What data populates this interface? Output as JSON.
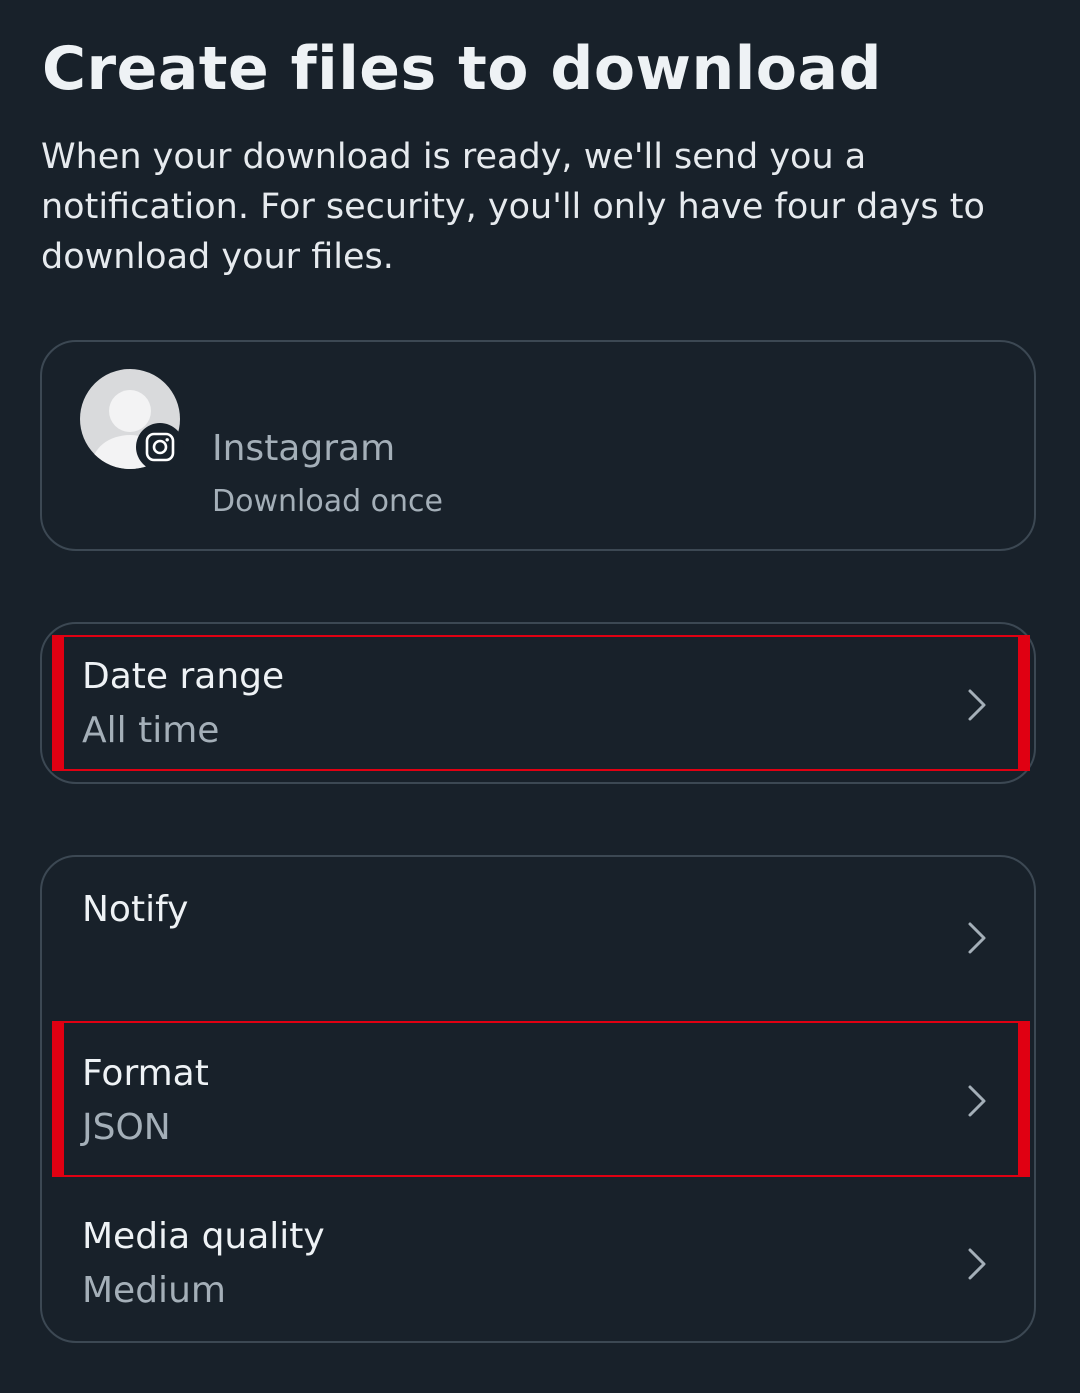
{
  "header": {
    "title": "Create files to download",
    "description": "When your download is ready, we'll send you a notification. For security, you'll only have four days to download your files."
  },
  "account": {
    "name": "Instagram",
    "download_mode": "Download once",
    "avatar_icon": "default-profile-avatar",
    "badge_icon": "instagram-icon"
  },
  "date_range": {
    "label": "Date range",
    "value": "All time"
  },
  "options": [
    {
      "label": "Notify",
      "value": ""
    },
    {
      "label": "Format",
      "value": "JSON"
    },
    {
      "label": "Media quality",
      "value": "Medium"
    }
  ],
  "colors": {
    "background": "#18212a",
    "card_border": "#3c4853",
    "primary_text": "#eef2f5",
    "secondary_text": "#a4afb8",
    "highlight": "#e00012"
  }
}
